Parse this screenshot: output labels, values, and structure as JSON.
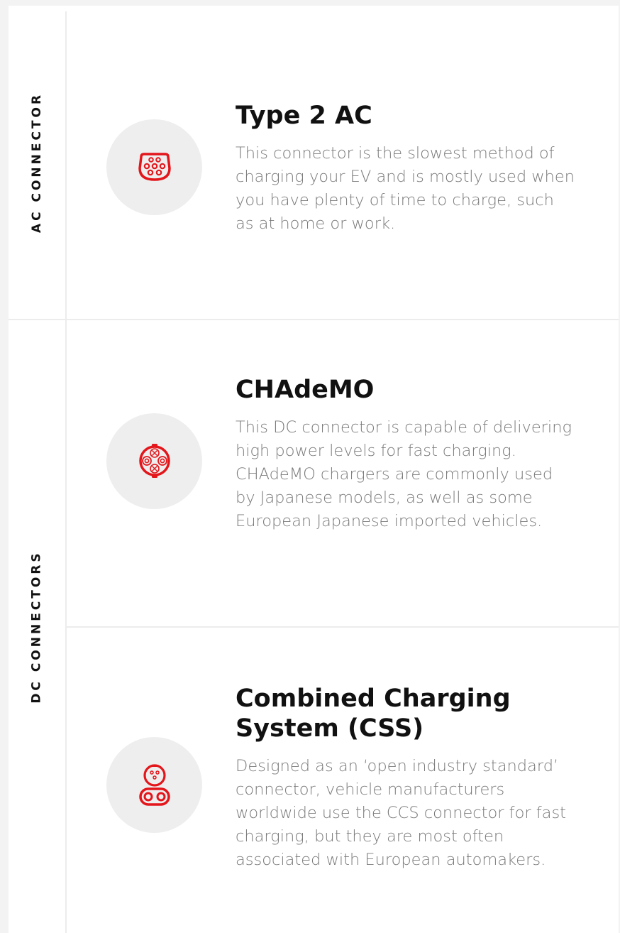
{
  "sections": {
    "ac_label": "AC CONNECTOR",
    "dc_label": "DC CONNECTORS"
  },
  "connectors": [
    {
      "title": "Type 2 AC",
      "description": "This connector is the slowest method of charging your EV and is mostly used when you have plenty of time to charge, such as at home or work.",
      "icon": "type2-connector-icon"
    },
    {
      "title": "CHAdeMO",
      "description": "This DC connector is capable of delivering high power levels for fast charging. CHAdeMO chargers are commonly used by Japanese models, as well as some European Japanese imported vehicles.",
      "icon": "chademo-connector-icon"
    },
    {
      "title": "Combined Charging System (CSS)",
      "description": "Designed as an ‘open industry standard’ connector, vehicle manufacturers worldwide use the CCS connector for fast charging, but they are most often associated with European automakers.",
      "icon": "ccs-connector-icon"
    }
  ],
  "colors": {
    "accent": "#e3161b",
    "icon_bg": "#eeeeee",
    "text_muted": "#7a7a7a",
    "divider": "#ececec"
  }
}
